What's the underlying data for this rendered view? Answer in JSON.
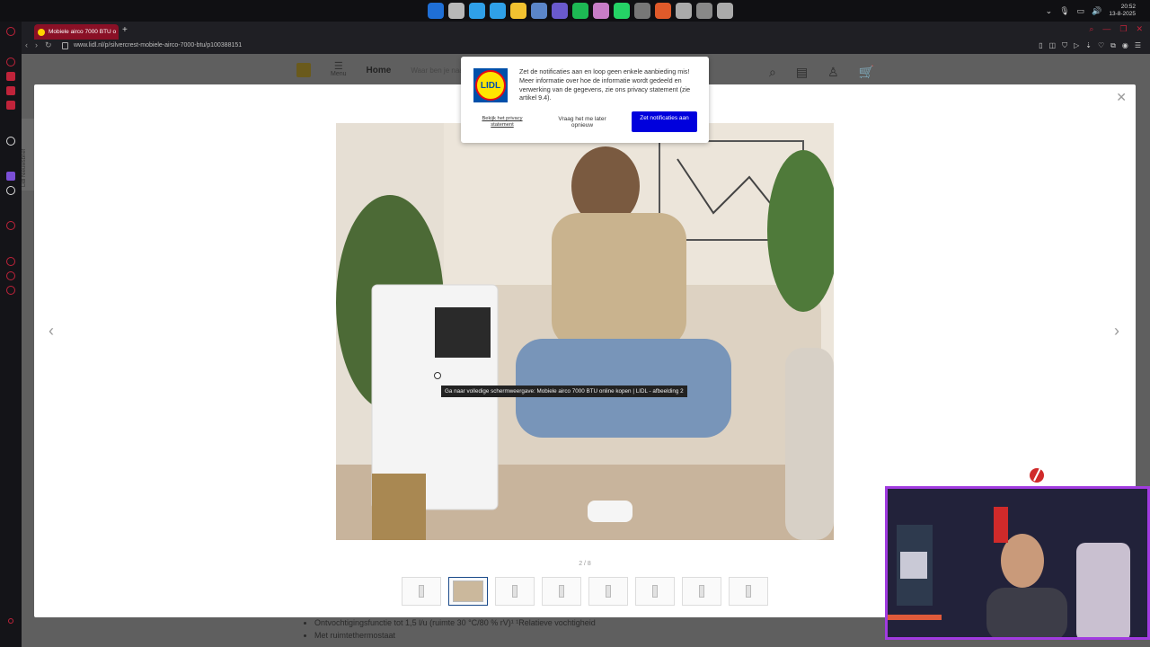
{
  "taskbar": {
    "app_colors": [
      "#1f6fd6",
      "#b8b8b8",
      "#2fa0e8",
      "#2fa0e8",
      "#f2c230",
      "#5b86c9",
      "#6a5acd",
      "#1db954",
      "#c77dc7",
      "#25d366",
      "#777",
      "#e05a2a",
      "#aaa",
      "#888",
      "#aaa"
    ],
    "clock_time": "20:52",
    "clock_date": "13-8-2025"
  },
  "browser": {
    "tab_label": "Mobiele airco 7000 BTU o",
    "url": "www.lidl.nl/p/silvercrest-mobiele-airco-7000-btu/p100388151"
  },
  "page": {
    "nav_menu_label": "Menu",
    "nav_home": "Home",
    "nav_search_hint": "Waar ben je naar",
    "side_tab": "Lidl Nieuwsbrief",
    "bullets": [
      "Ontvochtigingsfunctie tot 1,5 l/u (ruimte 30 °C/80 % rV)¹ ¹Relatieve vochtigheid",
      "Met ruimtethermostaat"
    ]
  },
  "gallery": {
    "counter": "2 / 8",
    "thumb_count": 8,
    "active_thumb": 2
  },
  "tooltip": "Ga naar volledige schermweergave: Mobiele airco 7000 BTU online kopen | LIDL - afbeelding 2",
  "notification": {
    "logo_text": "LIDL",
    "message": "Zet de notificaties aan en loop geen enkele aanbieding mis! Meer informatie over hoe de informatie wordt gedeeld en verwerking van de gegevens, zie ons privacy statement (zie artikel 9.4).",
    "privacy_link": "Bekijk het privacy statement",
    "later_button": "Vraag het me later opnieuw",
    "accept_button": "Zet notificaties aan",
    "accept_color": "#0000dd"
  },
  "colors": {
    "accent": "#c0233a",
    "cam_border": "#a13be0"
  }
}
